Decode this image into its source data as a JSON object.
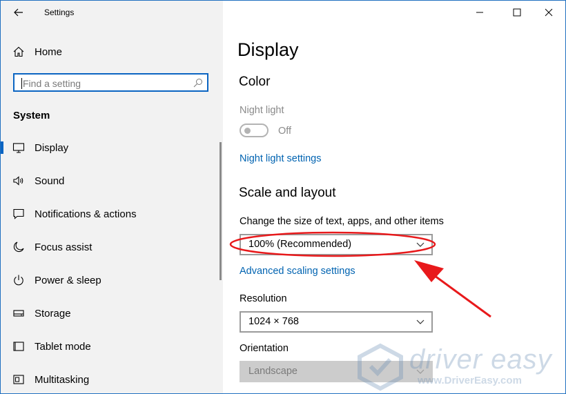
{
  "window": {
    "title": "Settings",
    "controls": {
      "minimize_icon": "minimize-icon",
      "maximize_icon": "maximize-icon",
      "close_icon": "close-icon"
    }
  },
  "sidebar": {
    "home_label": "Home",
    "search": {
      "placeholder": "Find a setting"
    },
    "section_title": "System",
    "items": [
      {
        "label": "Display",
        "icon": "monitor-icon",
        "selected": true
      },
      {
        "label": "Sound",
        "icon": "speaker-icon",
        "selected": false
      },
      {
        "label": "Notifications & actions",
        "icon": "notification-icon",
        "selected": false
      },
      {
        "label": "Focus assist",
        "icon": "moon-icon",
        "selected": false
      },
      {
        "label": "Power & sleep",
        "icon": "power-icon",
        "selected": false
      },
      {
        "label": "Storage",
        "icon": "storage-icon",
        "selected": false
      },
      {
        "label": "Tablet mode",
        "icon": "tablet-icon",
        "selected": false
      },
      {
        "label": "Multitasking",
        "icon": "multitasking-icon",
        "selected": false
      }
    ]
  },
  "main": {
    "page_title": "Display",
    "color_heading": "Color",
    "night_light_label": "Night light",
    "night_light_state": "Off",
    "night_light_settings_link": "Night light settings",
    "scale_heading": "Scale and layout",
    "scale_label": "Change the size of text, apps, and other items",
    "scale_value": "100% (Recommended)",
    "advanced_scaling_link": "Advanced scaling settings",
    "resolution_label": "Resolution",
    "resolution_value": "1024 × 768",
    "orientation_label": "Orientation",
    "orientation_value": "Landscape"
  },
  "watermark": {
    "brand": "driver easy",
    "url": "www.DriverEasy.com"
  },
  "colors": {
    "accent": "#0a64c2",
    "link": "#0063b1",
    "annotation": "#e8191b",
    "sidebar_bg": "#f2f2f2"
  }
}
